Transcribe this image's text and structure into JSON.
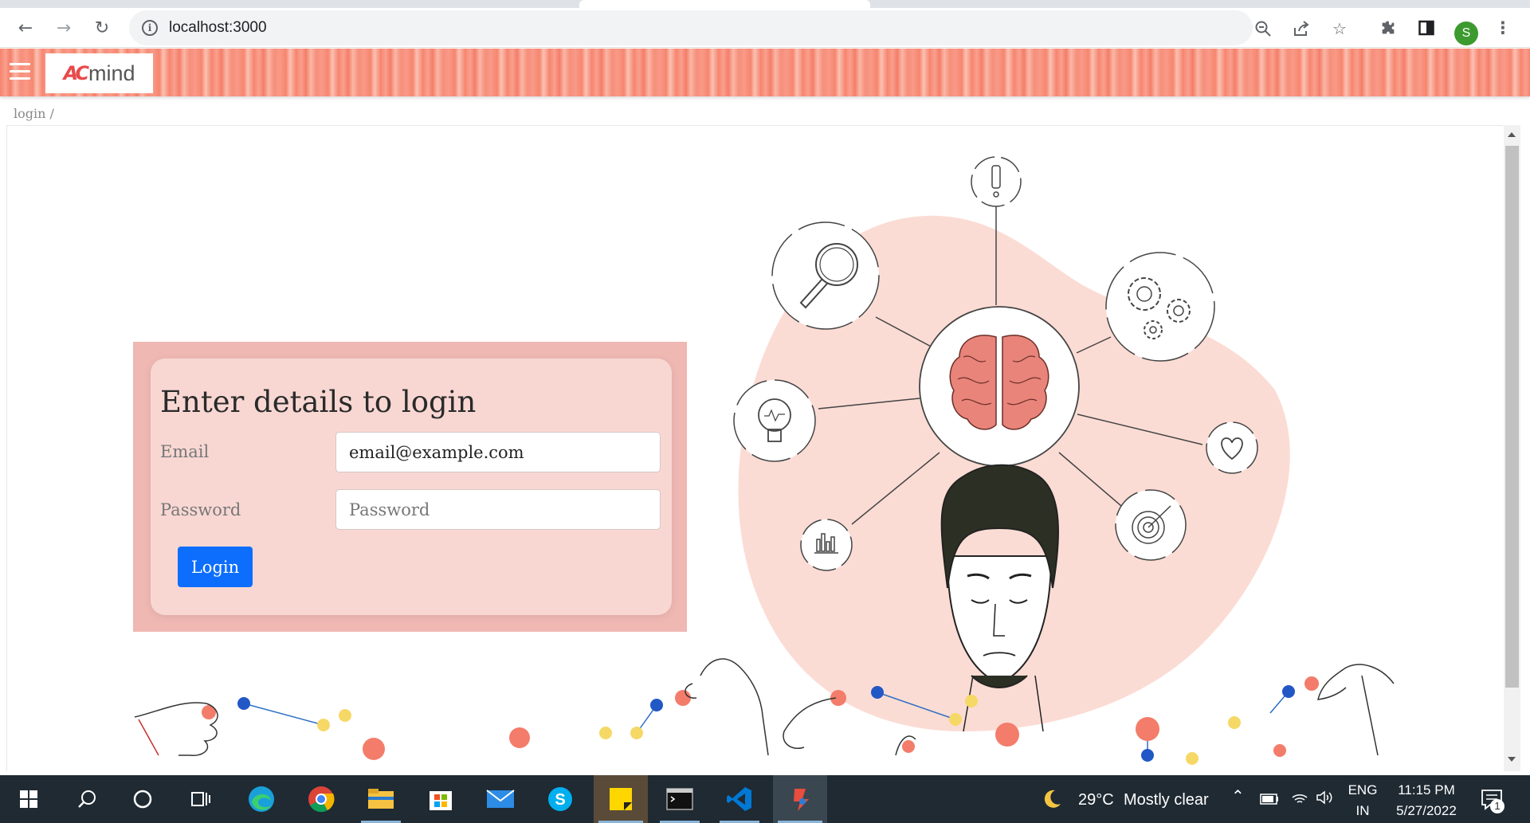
{
  "browser": {
    "url": "localhost:3000",
    "profile_initial": "S",
    "icons": [
      "back-icon",
      "forward-icon",
      "reload-icon",
      "info-icon",
      "zoom-out-icon",
      "share-icon",
      "bookmark-star-icon",
      "extensions-icon",
      "side-panel-icon",
      "menu-dots-icon"
    ]
  },
  "app": {
    "logo_mark": "AC",
    "logo_text": "mind",
    "breadcrumb": "login /"
  },
  "login": {
    "title": "Enter details to login",
    "email_label": "Email",
    "email_value": "email@example.com",
    "password_label": "Password",
    "password_placeholder": "Password",
    "button_label": "Login"
  },
  "taskbar": {
    "weather_temp": "29°C",
    "weather_text": "Mostly clear",
    "lang_line1": "ENG",
    "lang_line2": "IN",
    "time": "11:15 PM",
    "date": "5/27/2022",
    "notification_count": "1",
    "apps": [
      "windows-start",
      "search",
      "cortana",
      "task-view",
      "edge",
      "chrome",
      "file-explorer",
      "store",
      "mail",
      "skype",
      "sticky-notes",
      "terminal",
      "vscode",
      "postman"
    ]
  },
  "colors": {
    "header_coral": "#f7836d",
    "card_pink": "#f8d7d3",
    "button_blue": "#0d6efd",
    "blob_pink": "#fbdcd4"
  }
}
